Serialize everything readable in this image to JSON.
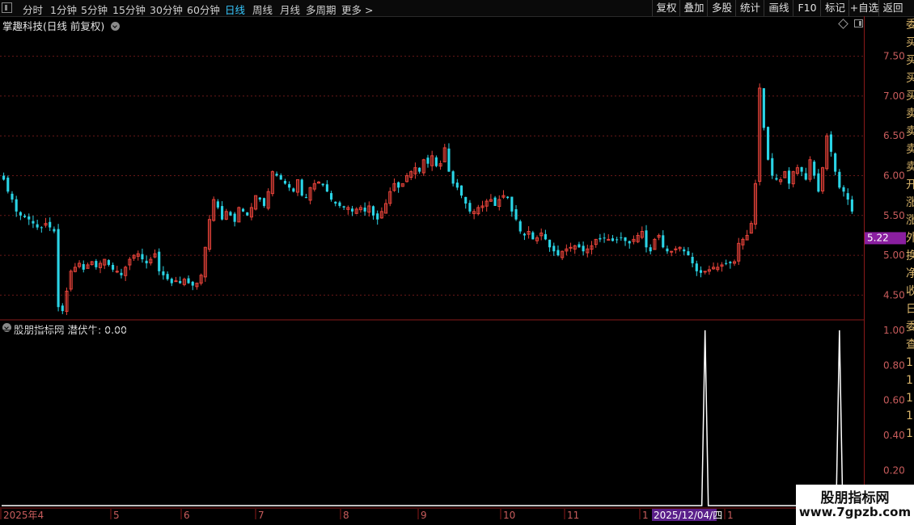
{
  "toolbar": {
    "periods": [
      "分时",
      "1分钟",
      "5分钟",
      "15分钟",
      "30分钟",
      "60分钟",
      "日线",
      "周线",
      "月线",
      "多周期",
      "更多 >"
    ],
    "active_period": "日线",
    "right_buttons": [
      "复权",
      "叠加",
      "多股",
      "统计",
      "画线",
      "F10",
      "标记",
      "+自选",
      "返回"
    ]
  },
  "stock_title": "掌趣科技(日线 前复权)",
  "indicator_title": "股朋指标网 潜伏牛: 0.00",
  "price_axis": [
    "7.50",
    "7.00",
    "6.50",
    "6.00",
    "5.50",
    "5.00",
    "4.50"
  ],
  "current_price_label": "5.22",
  "indicator_axis": [
    "1.00",
    "0.80",
    "0.60",
    "0.40",
    "0.20"
  ],
  "date_axis": [
    "2025年4",
    "5",
    "6",
    "7",
    "8",
    "9",
    "10",
    "11",
    "1",
    "1"
  ],
  "date_cursor_label": "2025/12/04/四",
  "right_strip_glyphs": [
    "委",
    "买",
    "买",
    "买",
    "买",
    "卖",
    "卖",
    "卖",
    "卖",
    "开",
    "涨",
    "涨",
    "外",
    "换",
    "净",
    "收",
    "日",
    "委",
    "查",
    "1",
    "1",
    "1",
    "1",
    "1"
  ],
  "colors": {
    "up": "#e8433a",
    "down": "#2ad4e6",
    "grid": "#6a1818",
    "axis_text": "#c85c5c",
    "title_accent": "#37c8ff"
  },
  "chart_data": [
    {
      "type": "candlestick",
      "title": "掌趣科技(日线 前复权)",
      "ylim": [
        4.2,
        7.8
      ],
      "yticks": [
        4.5,
        5.0,
        5.5,
        6.0,
        6.5,
        7.0,
        7.5
      ],
      "x_month_labels": [
        "2025年4",
        "5",
        "6",
        "7",
        "8",
        "9",
        "10",
        "11",
        "1",
        "1"
      ],
      "last_price": 5.22,
      "close_series": [
        5.95,
        5.8,
        5.7,
        5.55,
        5.5,
        5.48,
        5.45,
        5.4,
        5.35,
        5.35,
        5.4,
        5.35,
        5.3,
        4.35,
        4.3,
        4.55,
        4.8,
        4.85,
        4.9,
        4.82,
        4.88,
        4.92,
        4.85,
        4.9,
        4.95,
        4.88,
        4.82,
        4.8,
        4.75,
        4.85,
        4.95,
        5.0,
        5.02,
        4.95,
        4.9,
        4.95,
        5.02,
        4.8,
        4.75,
        4.7,
        4.65,
        4.68,
        4.65,
        4.7,
        4.65,
        4.62,
        4.65,
        4.75,
        5.1,
        5.45,
        5.7,
        5.6,
        5.45,
        5.55,
        5.5,
        5.42,
        5.6,
        5.55,
        5.5,
        5.6,
        5.75,
        5.7,
        5.62,
        5.8,
        6.05,
        6.0,
        5.95,
        5.9,
        5.85,
        5.8,
        5.95,
        5.75,
        5.72,
        5.85,
        5.9,
        5.92,
        5.88,
        5.8,
        5.7,
        5.65,
        5.62,
        5.6,
        5.6,
        5.55,
        5.58,
        5.6,
        5.55,
        5.62,
        5.5,
        5.45,
        5.55,
        5.65,
        5.8,
        5.9,
        5.85,
        5.9,
        6.0,
        6.05,
        6.1,
        6.05,
        6.2,
        6.15,
        6.25,
        6.12,
        6.15,
        6.35,
        6.05,
        5.9,
        5.85,
        5.75,
        5.65,
        5.55,
        5.55,
        5.6,
        5.62,
        5.68,
        5.7,
        5.62,
        5.7,
        5.75,
        5.72,
        5.55,
        5.45,
        5.3,
        5.25,
        5.3,
        5.2,
        5.22,
        5.28,
        5.2,
        5.1,
        5.05,
        5.0,
        5.05,
        5.08,
        5.1,
        5.12,
        5.1,
        5.05,
        5.08,
        5.12,
        5.2,
        5.2,
        5.22,
        5.2,
        5.18,
        5.2,
        5.22,
        5.18,
        5.15,
        5.2,
        5.25,
        5.3,
        5.1,
        5.05,
        5.2,
        5.25,
        5.1,
        5.05,
        5.05,
        5.08,
        5.1,
        5.05,
        5.0,
        4.9,
        4.8,
        4.78,
        4.8,
        4.82,
        4.85,
        4.85,
        4.88,
        4.9,
        4.9,
        4.92,
        5.15,
        5.2,
        5.25,
        5.4,
        5.9,
        7.1,
        6.6,
        6.2,
        6.0,
        5.95,
        5.95,
        6.05,
        5.9,
        6.05,
        6.1,
        6.05,
        5.95,
        6.2,
        6.0,
        5.8,
        6.1,
        6.5,
        6.3,
        6.05,
        5.85,
        5.8,
        5.7,
        5.55
      ],
      "indicator": {
        "name": "潜伏牛",
        "current_value": 0.0,
        "ylim": [
          0,
          1.05
        ],
        "spike_indices": [
          167,
          199
        ],
        "spike_value": 1.0
      }
    }
  ]
}
